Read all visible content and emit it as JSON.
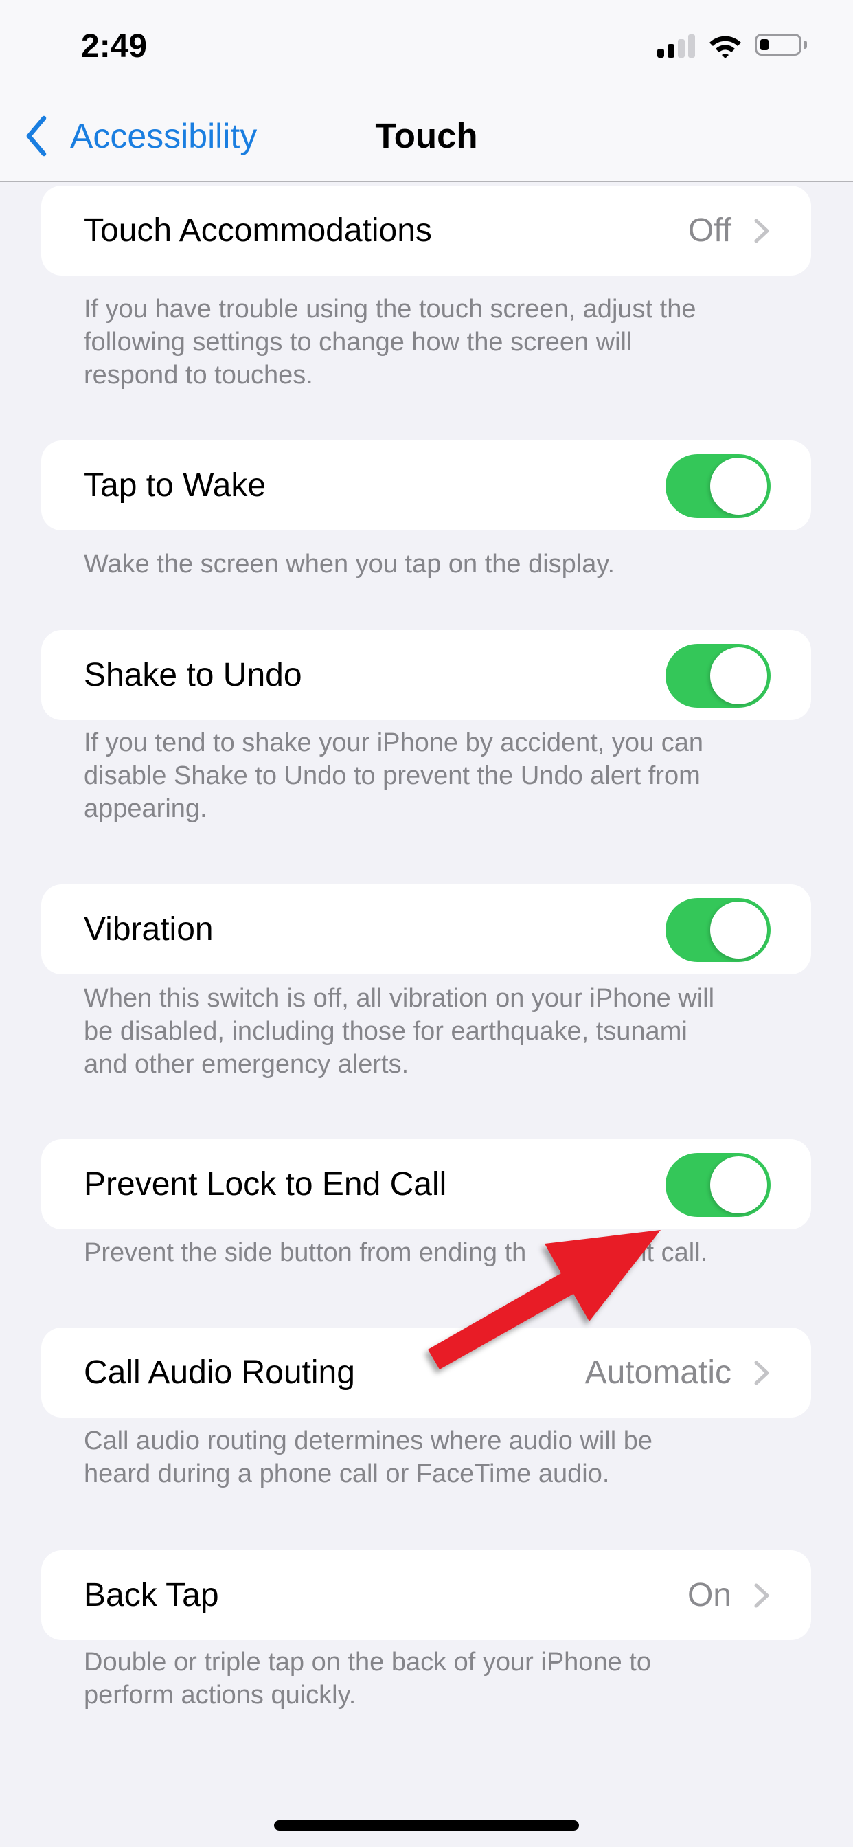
{
  "status_bar": {
    "time": "2:49",
    "signal_bars_active": 2,
    "signal_bars_total": 4,
    "battery_level": "low",
    "icons": [
      "cellular-signal-icon",
      "wifi-icon",
      "battery-icon"
    ]
  },
  "nav": {
    "back_label": "Accessibility",
    "back_icon": "chevron-left-icon",
    "title": "Touch"
  },
  "colors": {
    "accent": "#1a7ee0",
    "toggle_on": "#34c759",
    "background": "#f2f2f7",
    "secondary_text": "#85858a",
    "annotation_arrow": "#e81e25"
  },
  "settings": [
    {
      "label": "Touch Accommodations",
      "type": "disclosure",
      "value": "Off",
      "footer": [
        "If you have trouble using the touch screen, adjust the",
        "following settings to change how the screen will",
        "respond to touches."
      ]
    },
    {
      "label": "Tap to Wake",
      "type": "toggle",
      "on": true,
      "footer": [
        "Wake the screen when you tap on the display."
      ]
    },
    {
      "label": "Shake to Undo",
      "type": "toggle",
      "on": true,
      "footer": [
        "If you tend to shake your iPhone by accident, you can",
        "disable Shake to Undo to prevent the Undo alert from",
        "appearing."
      ]
    },
    {
      "label": "Vibration",
      "type": "toggle",
      "on": true,
      "footer": [
        "When this switch is off, all vibration on your iPhone will",
        "be disabled, including those for earthquake, tsunami",
        "and other emergency alerts."
      ]
    },
    {
      "label": "Prevent Lock to End Call",
      "type": "toggle",
      "on": true,
      "footer": [
        "Prevent the side button from ending th    ent call."
      ]
    },
    {
      "label": "Call Audio Routing",
      "type": "disclosure",
      "value": "Automatic",
      "footer": [
        "Call audio routing determines where audio will be",
        "heard during a phone call or FaceTime audio."
      ]
    },
    {
      "label": "Back Tap",
      "type": "disclosure",
      "value": "On",
      "footer": [
        "Double or triple tap on the back of your iPhone to",
        "perform actions quickly."
      ]
    }
  ],
  "annotation": {
    "type": "arrow",
    "points_to": "Prevent Lock to End Call toggle"
  }
}
